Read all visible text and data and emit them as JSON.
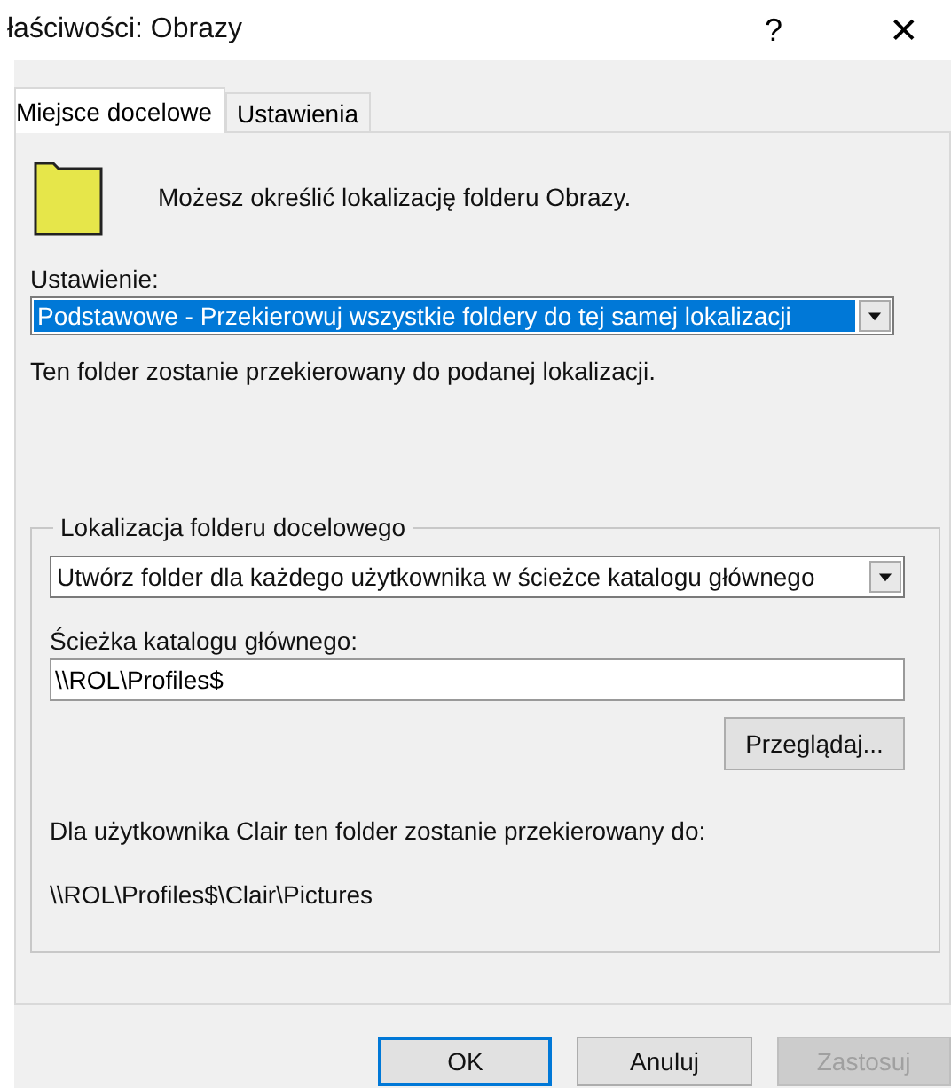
{
  "window": {
    "title": "łaściwości: Obrazy",
    "help": "?",
    "close": "✕"
  },
  "tabs": [
    {
      "label": "Miejsce docelowe",
      "selected": true
    },
    {
      "label": "Ustawienia",
      "selected": false
    }
  ],
  "intro": "Możesz określić lokalizację folderu Obrazy.",
  "setting": {
    "label": "Ustawienie:",
    "value": "Podstawowe - Przekierowuj wszystkie foldery do tej samej lokalizacji",
    "description": "Ten folder zostanie przekierowany do podanej lokalizacji."
  },
  "target_group": {
    "legend": "Lokalizacja folderu docelowego",
    "option": "Utwórz folder dla każdego użytkownika w ścieżce katalogu głównego",
    "path_label": "Ścieżka katalogu głównego:",
    "path_value": "\\\\ROL\\Profiles$",
    "browse": "Przeglądaj...",
    "result_label": "Dla użytkownika Clair ten folder zostanie przekierowany do:",
    "result_path": "\\\\ROL\\Profiles$\\Clair\\Pictures"
  },
  "buttons": [
    {
      "label": "OK",
      "kind": "default",
      "disabled": false
    },
    {
      "label": "Anuluj",
      "kind": "normal",
      "disabled": false
    },
    {
      "label": "Zastosuj",
      "kind": "normal",
      "disabled": true
    }
  ]
}
